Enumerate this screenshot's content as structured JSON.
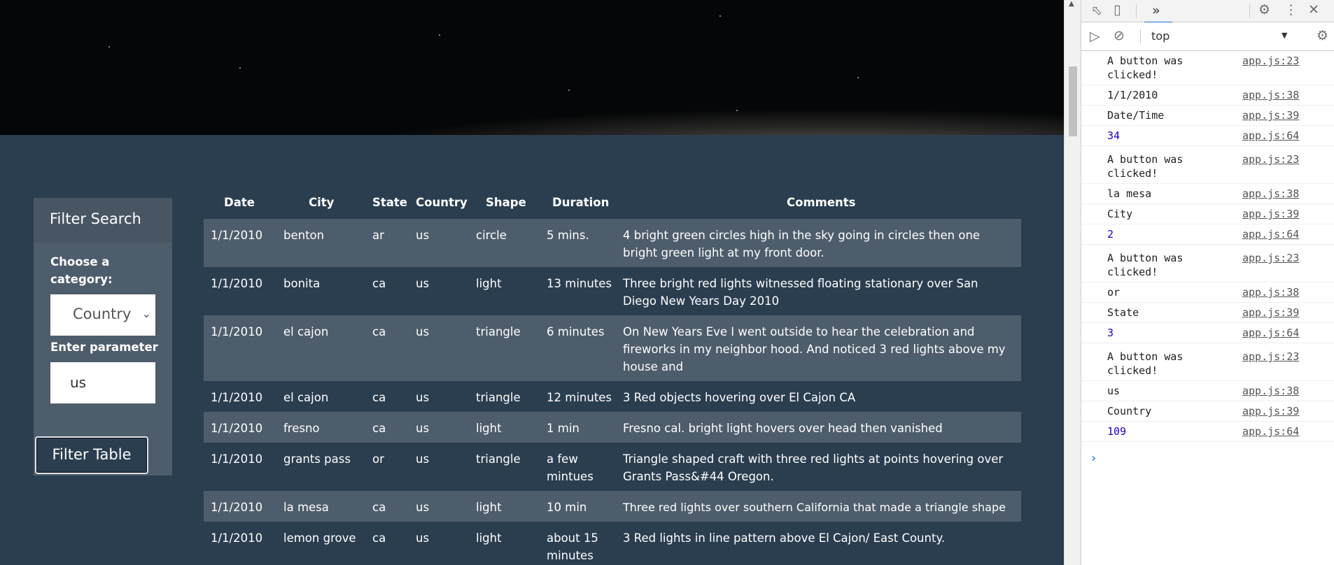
{
  "filter": {
    "title": "Filter Search",
    "category_label": "Choose a category:",
    "category_value": "Country",
    "parameter_label": "Enter parameter",
    "parameter_value": "us",
    "button_label": "Filter Table"
  },
  "table": {
    "headers": [
      "Date",
      "City",
      "State",
      "Country",
      "Shape",
      "Duration",
      "Comments"
    ],
    "rows": [
      {
        "date": "1/1/2010",
        "city": "benton",
        "state": "ar",
        "country": "us",
        "shape": "circle",
        "duration": "5 mins.",
        "comments": "4 bright green circles high in the sky going in circles then one bright green light at my front door."
      },
      {
        "date": "1/1/2010",
        "city": "bonita",
        "state": "ca",
        "country": "us",
        "shape": "light",
        "duration": "13 minutes",
        "comments": "Three bright red lights witnessed floating stationary over San Diego New Years Day 2010"
      },
      {
        "date": "1/1/2010",
        "city": "el cajon",
        "state": "ca",
        "country": "us",
        "shape": "triangle",
        "duration": "6 minutes",
        "comments": "On New Years Eve I went outside to hear the celebration and fireworks in my neighbor hood. And noticed 3 red lights above my house and"
      },
      {
        "date": "1/1/2010",
        "city": "el cajon",
        "state": "ca",
        "country": "us",
        "shape": "triangle",
        "duration": "12 minutes",
        "comments": "3 Red objects hovering over El Cajon CA"
      },
      {
        "date": "1/1/2010",
        "city": "fresno",
        "state": "ca",
        "country": "us",
        "shape": "light",
        "duration": "1 min",
        "comments": "Fresno cal. bright light hovers over head then vanished"
      },
      {
        "date": "1/1/2010",
        "city": "grants pass",
        "state": "or",
        "country": "us",
        "shape": "triangle",
        "duration": "a few mintues",
        "comments": "Triangle shaped craft with three red lights at points hovering over Grants Pass&#44 Oregon."
      },
      {
        "date": "1/1/2010",
        "city": "la mesa",
        "state": "ca",
        "country": "us",
        "shape": "light",
        "duration": "10 min",
        "comments": "Three red lights over southern California that made a triangle shape"
      },
      {
        "date": "1/1/2010",
        "city": "lemon grove",
        "state": "ca",
        "country": "us",
        "shape": "light",
        "duration": "about 15 minutes",
        "comments": "3 Red lights in line pattern above El Cajon/ East County."
      }
    ]
  },
  "devtools": {
    "context": "top",
    "console": [
      {
        "msg": "A button was clicked!",
        "src": "app.js:23",
        "kind": "text"
      },
      {
        "msg": "1/1/2010",
        "src": "app.js:38",
        "kind": "text"
      },
      {
        "msg": "Date/Time",
        "src": "app.js:39",
        "kind": "text"
      },
      {
        "msg": "34",
        "src": "app.js:64",
        "kind": "number"
      },
      {
        "msg": "A button was clicked!",
        "src": "app.js:23",
        "kind": "text"
      },
      {
        "msg": "la mesa",
        "src": "app.js:38",
        "kind": "text"
      },
      {
        "msg": "City",
        "src": "app.js:39",
        "kind": "text"
      },
      {
        "msg": "2",
        "src": "app.js:64",
        "kind": "number"
      },
      {
        "msg": "A button was clicked!",
        "src": "app.js:23",
        "kind": "text"
      },
      {
        "msg": "or",
        "src": "app.js:38",
        "kind": "text"
      },
      {
        "msg": "State",
        "src": "app.js:39",
        "kind": "text"
      },
      {
        "msg": "3",
        "src": "app.js:64",
        "kind": "number"
      },
      {
        "msg": "A button was clicked!",
        "src": "app.js:23",
        "kind": "text"
      },
      {
        "msg": "us",
        "src": "app.js:38",
        "kind": "text"
      },
      {
        "msg": "Country",
        "src": "app.js:39",
        "kind": "text"
      },
      {
        "msg": "109",
        "src": "app.js:64",
        "kind": "number"
      }
    ]
  }
}
